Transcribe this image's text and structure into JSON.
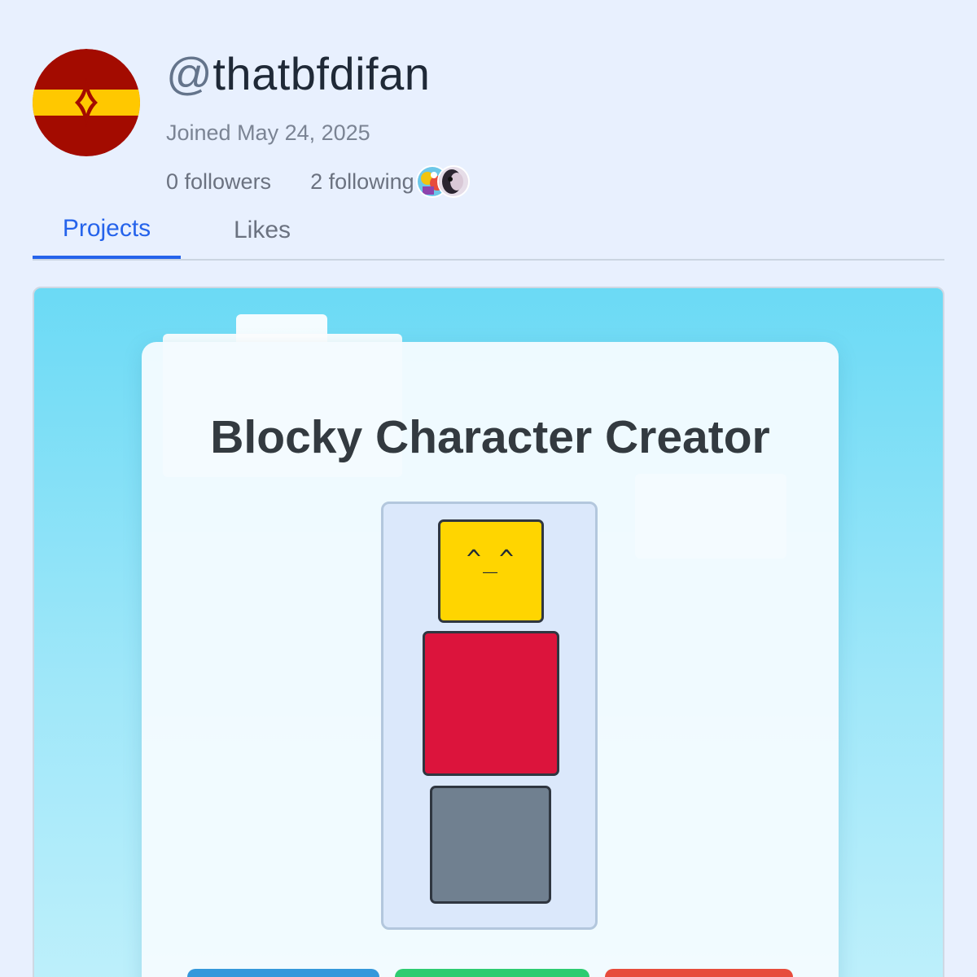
{
  "profile": {
    "at_symbol": "@",
    "handle": "thatbfdifan",
    "joined": "Joined May 24, 2025",
    "followers": "0 followers",
    "following": "2 following",
    "avatar_colors": {
      "outer": "#a30b00",
      "band": "#ffc800"
    }
  },
  "tabs": [
    {
      "label": "Projects",
      "active": true
    },
    {
      "label": "Likes",
      "active": false
    }
  ],
  "project": {
    "title": "Blocky Character Creator",
    "face": "^_^",
    "colors": {
      "head": "#ffd500",
      "torso": "#dc143c",
      "legs": "#708090",
      "button_1": "#3498db",
      "button_2": "#2ecc71",
      "button_3": "#e74c3c"
    }
  }
}
